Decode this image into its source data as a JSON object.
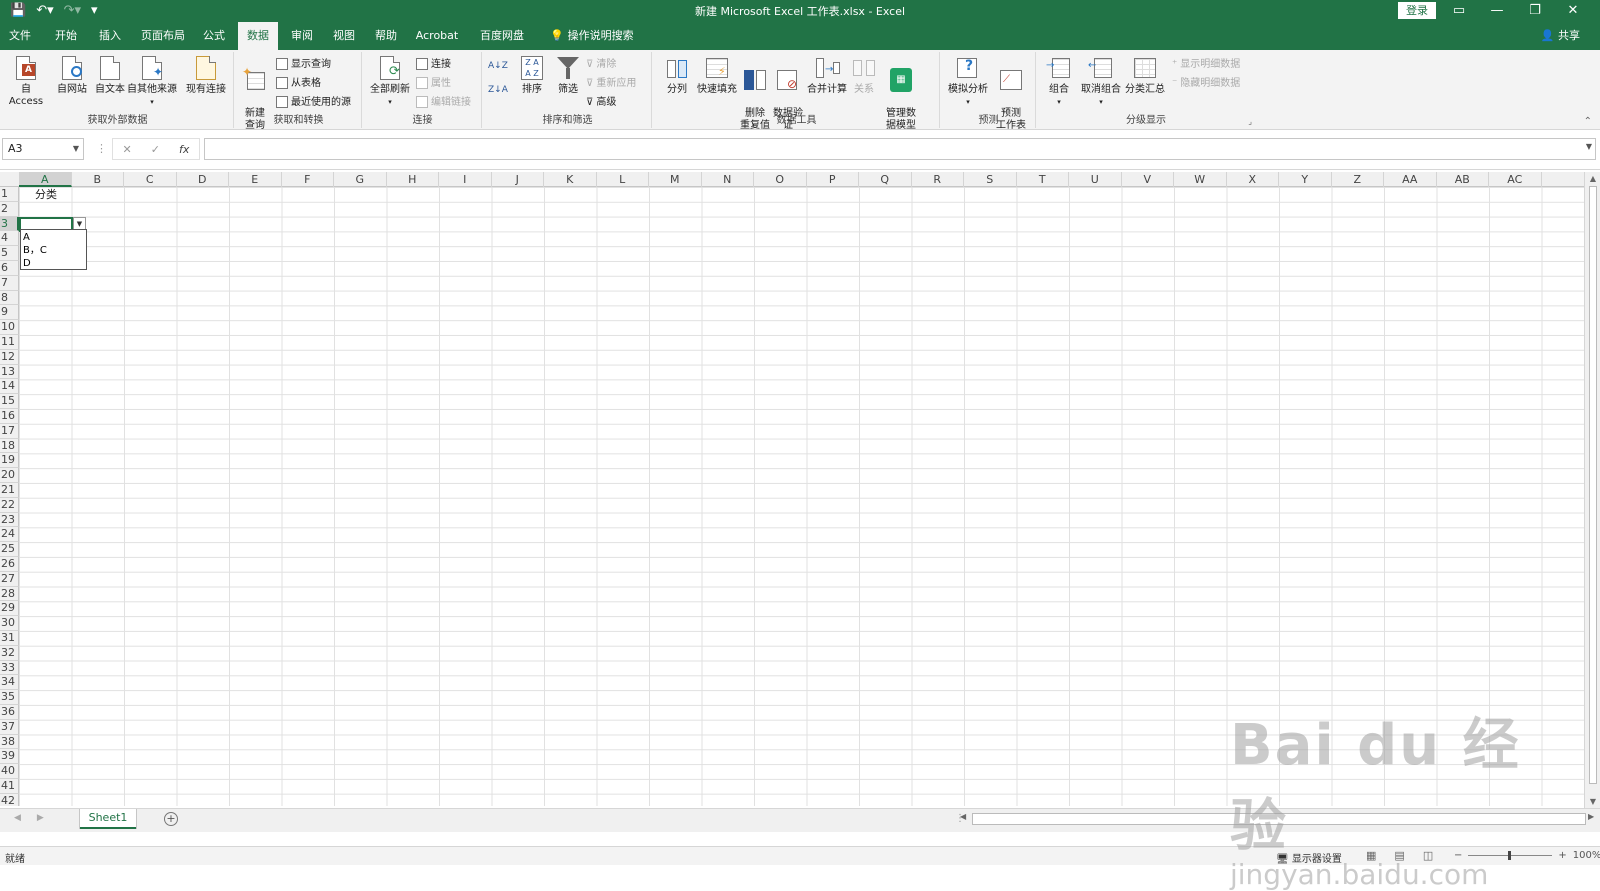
{
  "window": {
    "title": "新建 Microsoft Excel 工作表.xlsx  -  Excel",
    "login_label": "登录",
    "share_label": "共享"
  },
  "qat": {
    "save": "💾",
    "undo": "↶▾",
    "redo": "↷▾",
    "customize": "▾"
  },
  "window_controls": {
    "ribbon_options": "▭",
    "minimize": "—",
    "restore": "❐",
    "close": "✕"
  },
  "tabs": [
    {
      "label": "文件"
    },
    {
      "label": "开始"
    },
    {
      "label": "插入"
    },
    {
      "label": "页面布局"
    },
    {
      "label": "公式"
    },
    {
      "label": "数据"
    },
    {
      "label": "审阅"
    },
    {
      "label": "视图"
    },
    {
      "label": "帮助"
    },
    {
      "label": "Acrobat"
    },
    {
      "label": "百度网盘"
    },
    {
      "label": "操作说明搜索"
    }
  ],
  "active_tab": "数据",
  "ribbon": {
    "get_external": {
      "name": "获取外部数据",
      "from_access": "自 Access",
      "from_web": "自网站",
      "from_text": "自文本",
      "from_other": "自其他来源",
      "existing": "现有连接"
    },
    "get_transform": {
      "name": "获取和转换",
      "new_query": "新建\n查询",
      "show_queries": "显示查询",
      "from_table": "从表格",
      "recent_sources": "最近使用的源"
    },
    "connections": {
      "name": "连接",
      "refresh_all": "全部刷新",
      "connections": "连接",
      "properties": "属性",
      "edit_links": "编辑链接"
    },
    "sort_filter": {
      "name": "排序和筛选",
      "sort": "排序",
      "filter": "筛选",
      "clear": "清除",
      "reapply": "重新应用",
      "advanced": "高级",
      "az": "A↓Z",
      "za": "Z↓A"
    },
    "data_tools": {
      "name": "数据工具",
      "text_to_columns": "分列",
      "flash_fill": "快速填充",
      "remove_dup": "删除\n重复值",
      "validation": "数据验\n证",
      "consolidate": "合并计算",
      "relationships": "关系",
      "data_model": "管理数\n据模型"
    },
    "forecast": {
      "name": "预测",
      "what_if": "模拟分析",
      "forecast_sheet": "预测\n工作表"
    },
    "outline": {
      "name": "分级显示",
      "group": "组合",
      "ungroup": "取消组合",
      "subtotal": "分类汇总",
      "show_detail": "显示明细数据",
      "hide_detail": "隐藏明细数据"
    }
  },
  "formula_bar": {
    "name_box": "A3",
    "cancel": "✕",
    "enter": "✓",
    "fx": "fx",
    "content": ""
  },
  "columns": [
    "A",
    "B",
    "C",
    "D",
    "E",
    "F",
    "G",
    "H",
    "I",
    "J",
    "K",
    "L",
    "M",
    "N",
    "O",
    "P",
    "Q",
    "R",
    "S",
    "T",
    "U",
    "V",
    "W",
    "X",
    "Y",
    "Z",
    "AA",
    "AB",
    "AC"
  ],
  "rows": [
    "1",
    "2",
    "3",
    "4",
    "5",
    "6",
    "7",
    "8",
    "9",
    "10",
    "11",
    "12",
    "13",
    "14",
    "15",
    "16",
    "17",
    "18",
    "19",
    "20",
    "21",
    "22",
    "23",
    "24",
    "25",
    "26",
    "27",
    "28",
    "29",
    "30",
    "31",
    "32",
    "33",
    "34",
    "35",
    "36",
    "37",
    "38",
    "39",
    "40",
    "41",
    "42"
  ],
  "cells": {
    "A1": "分类"
  },
  "selected": {
    "col": "A",
    "row": "3"
  },
  "dropdown": {
    "items": [
      "A",
      "B，C",
      "D"
    ]
  },
  "sheets": [
    {
      "name": "Sheet1"
    }
  ],
  "status": {
    "ready": "就绪",
    "display_settings": "显示器设置",
    "zoom": "100%"
  },
  "watermark": {
    "line1": "Bai du 经验",
    "line2": "jingyan.baidu.com"
  }
}
